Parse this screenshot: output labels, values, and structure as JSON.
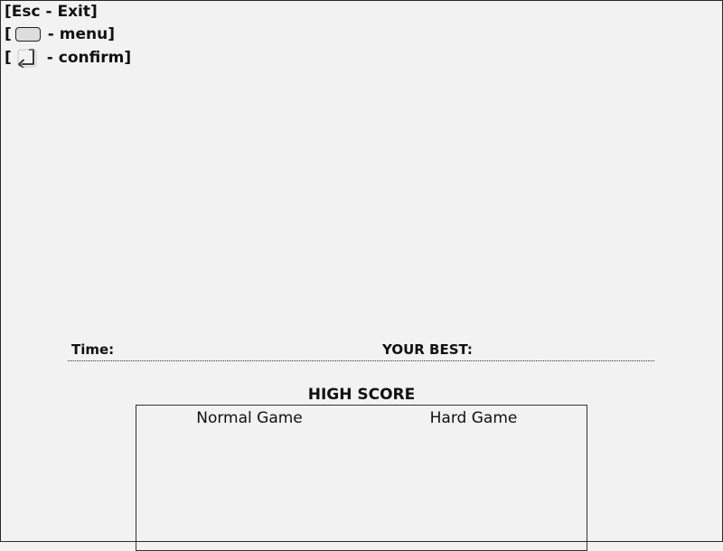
{
  "controls": {
    "exit": "[Esc - Exit]",
    "menu_open": "[",
    "menu_label": "- menu]",
    "confirm_open": "[",
    "confirm_label": "- confirm]"
  },
  "icons": {
    "menu_key": "space-key-icon",
    "confirm_key": "enter-key-icon"
  },
  "stats": {
    "time_label": "Time:",
    "best_label": "YOUR BEST:"
  },
  "high_score": {
    "title": "HIGH SCORE",
    "columns": [
      "Normal Game",
      "Hard Game"
    ]
  },
  "colors": {
    "background": "#f2f2f2",
    "text": "#111111"
  }
}
